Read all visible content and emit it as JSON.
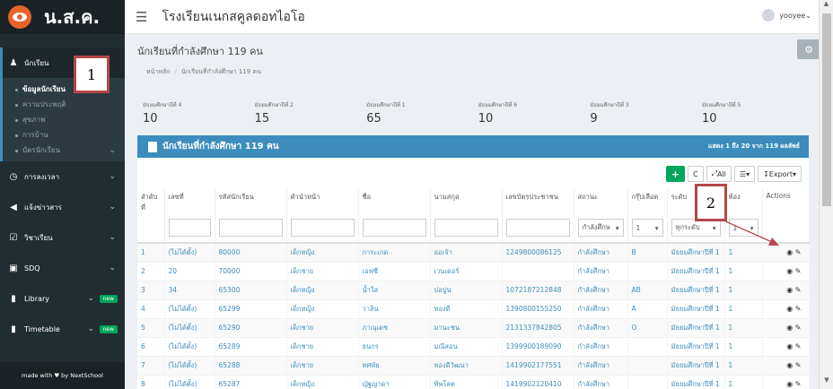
{
  "brand": {
    "name": "น.ส.ค."
  },
  "sidebar": {
    "items": [
      {
        "label": "นักเรียน",
        "icon": "users-icon",
        "sub": [
          "ข้อมูลนักเรียน",
          "ความประพฤติ",
          "สุขภาพ",
          "การบ้าน",
          "บัตรนักเรียน"
        ]
      },
      {
        "label": "การลงเวลา",
        "icon": "clock-icon"
      },
      {
        "label": "แจ้งข่าวสาร",
        "icon": "megaphone-icon"
      },
      {
        "label": "วิชาเรียน",
        "icon": "calendar-icon"
      },
      {
        "label": "SDQ",
        "icon": "clipboard-icon"
      },
      {
        "label": "Library",
        "icon": "book-icon",
        "badge": "new"
      },
      {
        "label": "Timetable",
        "icon": "file-icon",
        "badge": "new"
      }
    ],
    "footer": {
      "made_with": "made with",
      "by": "by NextSchool"
    }
  },
  "topbar": {
    "school_name": "โรงเรียนเนกสคูลดอทไอโอ",
    "user": "yooyee"
  },
  "page": {
    "title": "นักเรียนที่กำลังศึกษา 119 คน",
    "breadcrumb": [
      "หน้าหลัก",
      "นักเรียนที่กำลังศึกษา 119 คน"
    ]
  },
  "stats": [
    {
      "label": "มัธยมศึกษาปีที่ 4",
      "value": "10"
    },
    {
      "label": "มัธยมศึกษาปีที่ 2",
      "value": "15"
    },
    {
      "label": "มัธยมศึกษาปีที่ 1",
      "value": "65"
    },
    {
      "label": "มัธยมศึกษาปีที่ 6",
      "value": "10"
    },
    {
      "label": "มัธยมศึกษาปีที่ 3",
      "value": "9"
    },
    {
      "label": "มัธยมศึกษาปีที่ 5",
      "value": "10"
    }
  ],
  "box": {
    "title": "นักเรียนที่กำลังศึกษา 119 คน",
    "range": "แสดง 1 ถึง 20 จาก 119 ผลลัพธ์",
    "toolbar": {
      "add": "+",
      "refresh": "C",
      "all": "All",
      "export": "Export"
    }
  },
  "table": {
    "headers": [
      "ลำดับที่",
      "เลขที่",
      "รหัสนักเรียน",
      "คำนำหน้า",
      "ชื่อ",
      "นามสกุล",
      "เลขบัตรประชาชน",
      "สถานะ",
      "กรุ๊ปเลือด",
      "ระดับ",
      "ห้อง",
      "Actions"
    ],
    "filters": {
      "status": "กำลังศึกษ",
      "blood": "1",
      "level": "ทุกระดับ",
      "room": "1"
    },
    "rows": [
      [
        "1",
        "(ไม่ได้ตั้ง)",
        "80000",
        "เด็กหญิง",
        "การะเกด",
        "ออเจ้า",
        "1249800086125",
        "กำลังศึกษา",
        "B",
        "มัธยมศึกษาปีที่ 1",
        "1"
      ],
      [
        "2",
        "20",
        "70000",
        "เด็กชาย",
        "เอฟซี",
        "เวนเดอร์",
        "",
        "กำลังศึกษา",
        "",
        "มัธยมศึกษาปีที่ 1",
        "1"
      ],
      [
        "3",
        "34",
        "65300",
        "เด็กหญิง",
        "น้ำใส",
        "บ่อปูน",
        "1072187212848",
        "กำลังศึกษา",
        "AB",
        "มัธยมศึกษาปีที่ 1",
        "1"
      ],
      [
        "4",
        "(ไม่ได้ตั้ง)",
        "65299",
        "เด็กหญิง",
        "วาลิน",
        "ทองดี",
        "1390800155250",
        "กำลังศึกษา",
        "A",
        "มัธยมศึกษาปีที่ 1",
        "1"
      ],
      [
        "5",
        "(ไม่ได้ตั้ง)",
        "65290",
        "เด็กชาย",
        "ภาณุเดช",
        "มานะชน",
        "2131337842805",
        "กำลังศึกษา",
        "O",
        "มัธยมศึกษาปีที่ 1",
        "1"
      ],
      [
        "6",
        "(ไม่ได้ตั้ง)",
        "65289",
        "เด็กชาย",
        "ธนกร",
        "มณีสอน",
        "1399900189090",
        "กำลังศึกษา",
        "",
        "มัธยมศึกษาปีที่ 1",
        "1"
      ],
      [
        "7",
        "(ไม่ได้ตั้ง)",
        "65288",
        "เด็กชาย",
        "ทศพัธ",
        "ทองดีวัฒนา",
        "1419902177551",
        "กำลังศึกษา",
        "",
        "มัธยมศึกษาปีที่ 1",
        "1"
      ],
      [
        "8",
        "(ไม่ได้ตั้ง)",
        "65287",
        "เด็กหญิง",
        "ญัฐญาดา",
        "ทิพโสต",
        "1419902120410",
        "กำลังศึกษา",
        "",
        "มัธยมศึกษาปีที่ 1",
        "1"
      ]
    ]
  },
  "annotations": {
    "one": "1",
    "two": "2"
  },
  "colors": {
    "primary": "#3c8dbc",
    "sidebar": "#222d32",
    "success": "#00a65a",
    "annotation": "#b6474b"
  }
}
